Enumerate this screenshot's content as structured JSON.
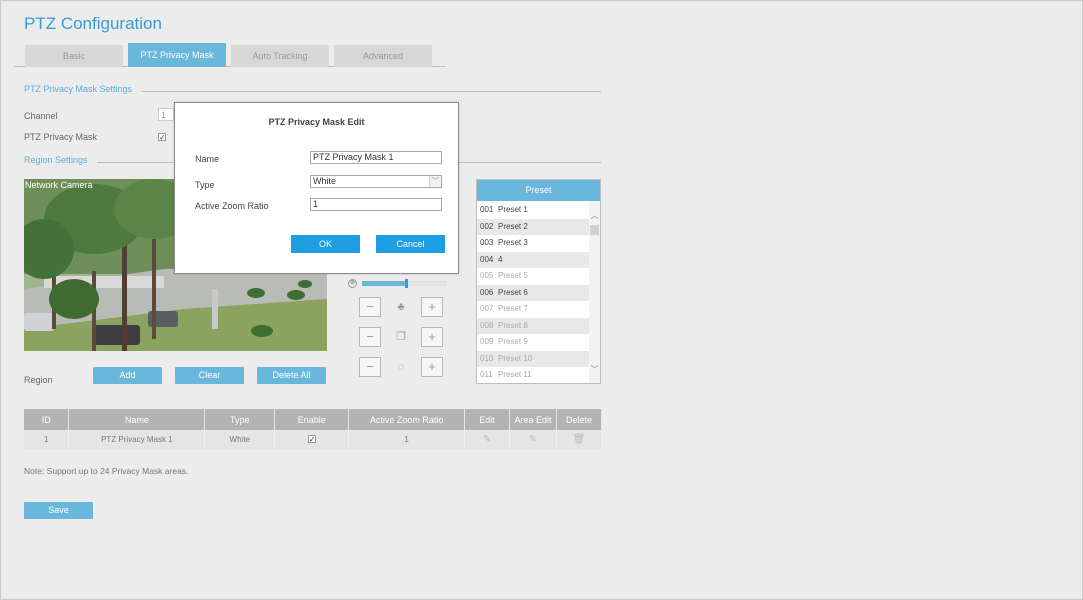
{
  "page": {
    "title": "PTZ Configuration"
  },
  "tabs": [
    {
      "label": "Basic"
    },
    {
      "label": "PTZ Privacy Mask",
      "active": true
    },
    {
      "label": "Auto Tracking"
    },
    {
      "label": "Advanced"
    }
  ],
  "settings": {
    "section_title": "PTZ Privacy Mask Settings",
    "channel_label": "Channel",
    "channel_value": "1",
    "mask_label": "PTZ Privacy Mask",
    "mask_enabled": true
  },
  "region": {
    "section_title": "Region Settings",
    "video_label": "Network Camera",
    "region_label": "Region",
    "add_label": "Add",
    "clear_label": "Clear",
    "delete_all_label": "Delete All"
  },
  "presets": {
    "header": "Preset",
    "items": [
      {
        "num": "001",
        "name": "Preset 1",
        "set": true
      },
      {
        "num": "002",
        "name": "Preset 2",
        "set": true
      },
      {
        "num": "003",
        "name": "Preset 3",
        "set": true
      },
      {
        "num": "004",
        "name": "4",
        "set": true
      },
      {
        "num": "005",
        "name": "Preset 5",
        "set": false
      },
      {
        "num": "006",
        "name": "Preset 6",
        "set": true
      },
      {
        "num": "007",
        "name": "Preset 7",
        "set": false
      },
      {
        "num": "008",
        "name": "Preset 8",
        "set": false
      },
      {
        "num": "009",
        "name": "Preset 9",
        "set": false
      },
      {
        "num": "010",
        "name": "Preset 10",
        "set": false
      },
      {
        "num": "011",
        "name": "Preset 11",
        "set": false
      }
    ]
  },
  "table": {
    "columns": [
      "ID",
      "Name",
      "Type",
      "Enable",
      "Active Zoom Ratio",
      "Edit",
      "Area Edit",
      "Delete"
    ],
    "rows": [
      {
        "id": "1",
        "name": "PTZ Privacy Mask 1",
        "type": "White",
        "enabled": true,
        "zoom": "1"
      }
    ]
  },
  "note": "Note: Support up to 24 Privacy Mask areas.",
  "save_label": "Save",
  "dialog": {
    "title": "PTZ Privacy Mask Edit",
    "name_label": "Name",
    "name_value": "PTZ Privacy Mask  1",
    "type_label": "Type",
    "type_value": "White",
    "zoom_label": "Active Zoom Ratio",
    "zoom_value": "1",
    "ok_label": "OK",
    "cancel_label": "Cancel"
  },
  "icons": {
    "minus": "minus-icon",
    "plus": "plus-icon",
    "zoom": "zoom-icon",
    "focus": "focus-icon",
    "iris": "iris-icon",
    "edit": "edit-icon",
    "delete": "trash-icon",
    "speed": "speed-icon"
  },
  "ptz": {
    "speed_level": 0.52
  },
  "colors": {
    "accent": "#6ab7dc",
    "title": "#3a9ad5",
    "dialog_button": "#1f9fe2"
  }
}
